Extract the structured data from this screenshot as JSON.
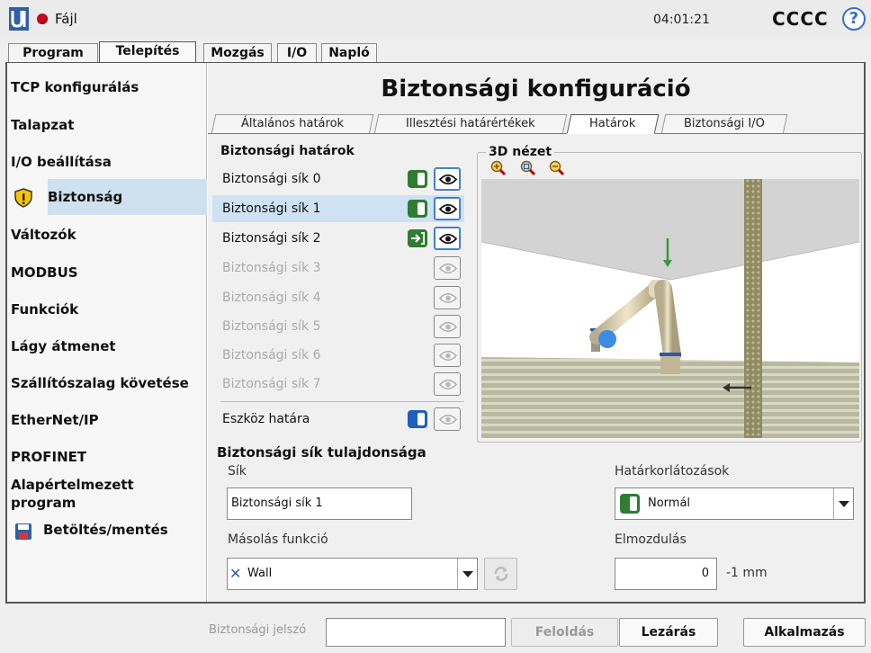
{
  "topbar": {
    "file_label": "Fájl",
    "time": "04:01:21",
    "robot_name": "CCCC",
    "help_symbol": "?"
  },
  "main_tabs": [
    {
      "label": "Program",
      "active": false
    },
    {
      "label": "Telepítés",
      "active": true
    },
    {
      "label": "Mozgás",
      "active": false
    },
    {
      "label": "I/O",
      "active": false
    },
    {
      "label": "Napló",
      "active": false
    }
  ],
  "sidebar": {
    "items": [
      {
        "label": "TCP konfigurálás"
      },
      {
        "label": "Talapzat"
      },
      {
        "label": "I/O beállítása"
      },
      {
        "label": "Biztonság",
        "selected": true,
        "icon": "shield-warning-icon"
      },
      {
        "label": "Változók"
      },
      {
        "label": "MODBUS"
      },
      {
        "label": "Funkciók"
      },
      {
        "label": "Lágy átmenet"
      },
      {
        "label": "Szállítószalag követése"
      },
      {
        "label": "EtherNet/IP"
      },
      {
        "label": "PROFINET"
      },
      {
        "label": "Alapértelmezett program"
      },
      {
        "label": "Betöltés/mentés",
        "icon": "save-disk-icon"
      }
    ]
  },
  "page": {
    "title": "Biztonsági konfiguráció",
    "subtabs": [
      {
        "label": "Általános határok"
      },
      {
        "label": "Illesztési határértékek"
      },
      {
        "label": "Határok",
        "active": true
      },
      {
        "label": "Biztonsági I/O"
      }
    ]
  },
  "boundaries": {
    "header": "Biztonsági határok",
    "planes": [
      {
        "label": "Biztonsági sík 0",
        "enabled": true
      },
      {
        "label": "Biztonsági sík 1",
        "enabled": true,
        "selected": true
      },
      {
        "label": "Biztonsági sík 2",
        "enabled": true
      },
      {
        "label": "Biztonsági sík 3",
        "enabled": false
      },
      {
        "label": "Biztonsági sík 4",
        "enabled": false
      },
      {
        "label": "Biztonsági sík 5",
        "enabled": false
      },
      {
        "label": "Biztonsági sík 6",
        "enabled": false
      },
      {
        "label": "Biztonsági sík 7",
        "enabled": false
      }
    ],
    "tool_limit_label": "Eszköz határa"
  },
  "view3d": {
    "title": "3D nézet"
  },
  "properties": {
    "header": "Biztonsági sík tulajdonsága",
    "plane_label": "Sík",
    "plane_value": "Biztonsági sík 1",
    "copy_label": "Másolás funkció",
    "copy_value": "Wall",
    "restriction_label": "Határkorlátozások",
    "restriction_value": "Normál",
    "displacement_label": "Elmozdulás",
    "displacement_value": "0",
    "displacement_unit": "-1 mm"
  },
  "bottombar": {
    "password_placeholder": "Biztonsági jelszó",
    "unlock_label": "Feloldás",
    "lock_label": "Lezárás",
    "apply_label": "Alkalmazás"
  },
  "colors": {
    "accent_blue": "#cfe0ee",
    "toggle_green": "#2e7d32",
    "record_red": "#d0021b"
  }
}
